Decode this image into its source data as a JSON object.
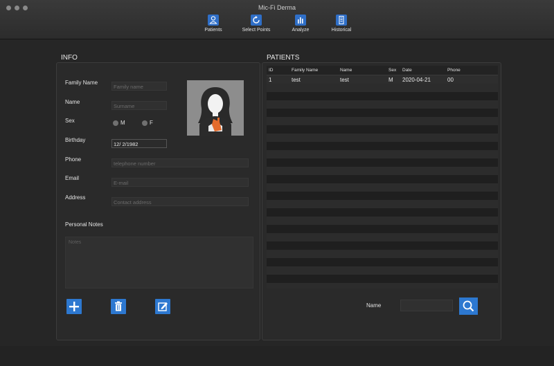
{
  "window": {
    "title": "Mic-Fi Derma"
  },
  "toolbar": {
    "items": [
      {
        "label": "Patients",
        "icon": "person-icon"
      },
      {
        "label": "Select Points",
        "icon": "refresh-icon"
      },
      {
        "label": "Analyze",
        "icon": "bar-chart-icon"
      },
      {
        "label": "Historical",
        "icon": "document-icon"
      }
    ]
  },
  "info": {
    "heading": "INFO",
    "family_name": {
      "label": "Family Name",
      "placeholder": "Family name",
      "value": ""
    },
    "name": {
      "label": "Name",
      "placeholder": "Surname",
      "value": ""
    },
    "sex": {
      "label": "Sex",
      "options": [
        "M",
        "F"
      ]
    },
    "birthday": {
      "label": "Birthday",
      "value": "12/ 2/1982"
    },
    "phone": {
      "label": "Phone",
      "placeholder": "telephone number",
      "value": ""
    },
    "email": {
      "label": "Email",
      "placeholder": "E-mail",
      "value": ""
    },
    "address": {
      "label": "Address",
      "placeholder": "Contact address",
      "value": ""
    },
    "notes": {
      "label": "Personal Notes",
      "placeholder": "Notes"
    },
    "actions": [
      "add-icon",
      "trash-icon",
      "edit-icon"
    ],
    "accent_color": "#2d78d0"
  },
  "patients": {
    "heading": "PATIENTS",
    "columns": [
      "ID",
      "Family Name",
      "Name",
      "Sex",
      "Date",
      "Phone"
    ],
    "rows": [
      {
        "id": "1",
        "family_name": "test",
        "name": "test",
        "sex": "M",
        "date": "2020-04-21",
        "phone": "00"
      }
    ],
    "search": {
      "label": "Name",
      "value": ""
    }
  }
}
